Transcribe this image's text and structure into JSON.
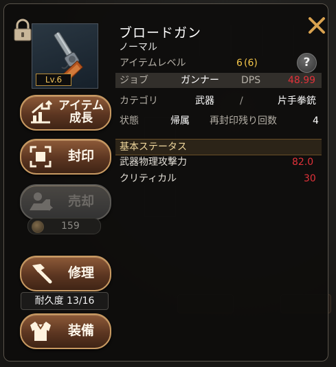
{
  "item": {
    "name": "ブロードガン",
    "grade": "ノーマル",
    "level_badge": "Lv.6"
  },
  "stats": {
    "item_level_label": "アイテムレベル",
    "item_level_value": "6",
    "item_level_base": "(6)",
    "job_label": "ジョブ",
    "job_value": "ガンナー",
    "dps_label": "DPS",
    "dps_value": "48.99",
    "category_label": "カテゴリ",
    "category_value": "武器",
    "category_sep": "/",
    "category_sub": "片手拳銃",
    "state_label": "状態",
    "state_value": "帰属",
    "reseal_label": "再封印残り回数",
    "reseal_value": "4"
  },
  "base_status": {
    "header": "基本ステータス",
    "rows": [
      {
        "label": "武器物理攻撃力",
        "value": "82.0"
      },
      {
        "label": "クリティカル",
        "value": "30"
      }
    ]
  },
  "actions": {
    "grow_line1": "アイテム",
    "grow_line2": "成長",
    "seal": "封印",
    "sell": "売却",
    "sell_price": "159",
    "repair": "修理",
    "durability": "耐久度 13/16",
    "equip": "装備"
  },
  "help_icon": "?",
  "colors": {
    "accent_gold": "#f4c64a",
    "dps_red": "#e2323a",
    "button_brown": "#5c3621",
    "section_text": "#f0d79d"
  },
  "icons": [
    "lock-icon",
    "close-icon",
    "help-icon",
    "growth-icon",
    "seal-icon",
    "sell-icon",
    "coin-icon",
    "hammer-icon",
    "armor-icon",
    "revolver-icon"
  ]
}
